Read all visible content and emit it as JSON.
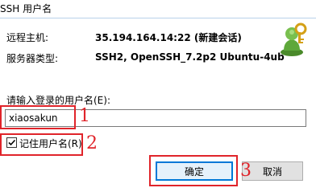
{
  "window": {
    "title": "SSH 用户名"
  },
  "info": {
    "remote_host_label": "远程主机:",
    "remote_host_value": "35.194.164.14:22 (新建会话)",
    "server_type_label": "服务器类型:",
    "server_type_value": "SSH2, OpenSSH_7.2p2 Ubuntu-4ub"
  },
  "form": {
    "prompt_label": "请输入登录的用户名(E):",
    "username_value": "xiaosakun",
    "remember_label": "记住用户名(R)",
    "remember_checked": true
  },
  "annotations": {
    "one": "1",
    "two": "2",
    "three": "3"
  },
  "buttons": {
    "ok_label": "确定",
    "cancel_label": "取消"
  },
  "colors": {
    "annotation_red": "#e0242a",
    "focus_blue": "#0078d7"
  }
}
